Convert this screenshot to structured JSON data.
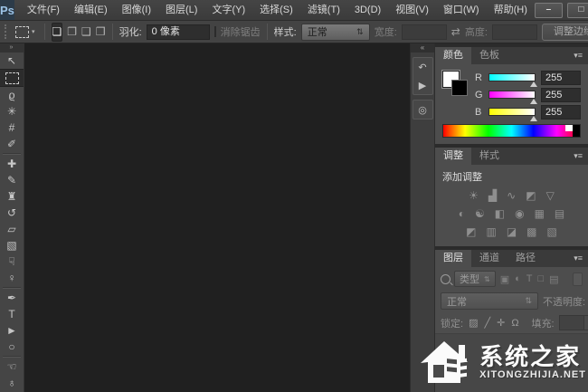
{
  "window": {
    "logo": "Ps",
    "controls": {
      "minimize": "–",
      "maximize": "□",
      "close": "×"
    }
  },
  "menu": {
    "items": [
      "文件(F)",
      "编辑(E)",
      "图像(I)",
      "图层(L)",
      "文字(Y)",
      "选择(S)",
      "滤镜(T)",
      "3D(D)",
      "视图(V)",
      "窗口(W)",
      "帮助(H)"
    ]
  },
  "options": {
    "tool_preset_caret": "▾",
    "mode_icons": [
      "❏",
      "❐",
      "❑",
      "❒"
    ],
    "feather_label": "羽化:",
    "feather_value": "0 像素",
    "antialias_label": "消除锯齿",
    "style_label": "样式:",
    "style_value": "正常",
    "style_stepper": "⇅",
    "width_label": "宽度:",
    "width_value": "",
    "swap_icon": "⇄",
    "height_label": "高度:",
    "height_value": "",
    "refine_edge_label": "调整边缘…"
  },
  "toolbar": {
    "expand_icon": "»",
    "tools": [
      {
        "name": "move-tool",
        "glyph": "↖"
      },
      {
        "name": "rectangular-marquee-tool",
        "glyph": ""
      },
      {
        "name": "lasso-tool",
        "glyph": "ϱ"
      },
      {
        "name": "magic-wand-tool",
        "glyph": "✳"
      },
      {
        "name": "crop-tool",
        "glyph": "#"
      },
      {
        "name": "eyedropper-tool",
        "glyph": "✐"
      },
      {
        "name": "healing-brush-tool",
        "glyph": "✚"
      },
      {
        "name": "brush-tool",
        "glyph": "✎"
      },
      {
        "name": "clone-stamp-tool",
        "glyph": "♜"
      },
      {
        "name": "history-brush-tool",
        "glyph": "↺"
      },
      {
        "name": "eraser-tool",
        "glyph": "▱"
      },
      {
        "name": "gradient-tool",
        "glyph": "▧"
      },
      {
        "name": "smudge-tool",
        "glyph": "☟"
      },
      {
        "name": "dodge-tool",
        "glyph": "♀"
      },
      {
        "name": "pen-tool",
        "glyph": "✒"
      },
      {
        "name": "type-tool",
        "glyph": "T"
      },
      {
        "name": "path-selection-tool",
        "glyph": "►"
      },
      {
        "name": "ellipse-tool",
        "glyph": "○"
      },
      {
        "name": "hand-tool",
        "glyph": "☜"
      },
      {
        "name": "zoom-tool",
        "glyph": "♁"
      }
    ]
  },
  "dock": {
    "expand_icon": "«",
    "buttons": [
      {
        "name": "history-panel",
        "glyph": "↶"
      },
      {
        "name": "actions-panel",
        "glyph": "▶"
      },
      {
        "name": "properties-panel",
        "glyph": "◎"
      }
    ]
  },
  "color_panel": {
    "tabs": [
      "颜色",
      "色板"
    ],
    "menu_icon": "▾≡",
    "channels": [
      {
        "label": "R",
        "value": "255"
      },
      {
        "label": "G",
        "value": "255"
      },
      {
        "label": "B",
        "value": "255"
      }
    ]
  },
  "adjustments_panel": {
    "tabs": [
      "调整",
      "样式"
    ],
    "menu_icon": "▾≡",
    "title": "添加调整",
    "rows": [
      {
        "icons": [
          "☀",
          "▟",
          "∿",
          "◩",
          "▽"
        ]
      },
      {
        "icons": [
          "◐",
          "☯",
          "◧",
          "◉",
          "▦",
          "▤"
        ]
      },
      {
        "icons": [
          "◩",
          "▥",
          "◪",
          "▩",
          "▧"
        ]
      }
    ]
  },
  "layers_panel": {
    "tabs": [
      "图层",
      "通道",
      "路径"
    ],
    "menu_icon": "▾≡",
    "kind_label": "类型",
    "kind_stepper": "⇅",
    "filter_icons": [
      "▣",
      "◐",
      "T",
      "□",
      "▤"
    ],
    "blend_mode": "正常",
    "blend_stepper": "⇅",
    "opacity_label": "不透明度:",
    "opacity_caret": "▾",
    "lock_label": "锁定:",
    "lock_icons": [
      "▨",
      "╱",
      "✛",
      "Ω"
    ],
    "fill_label": "填充:",
    "fill_caret": "▾"
  },
  "watermark": {
    "name": "系统之家",
    "domain": "XITONGZHIJIA.NET"
  }
}
